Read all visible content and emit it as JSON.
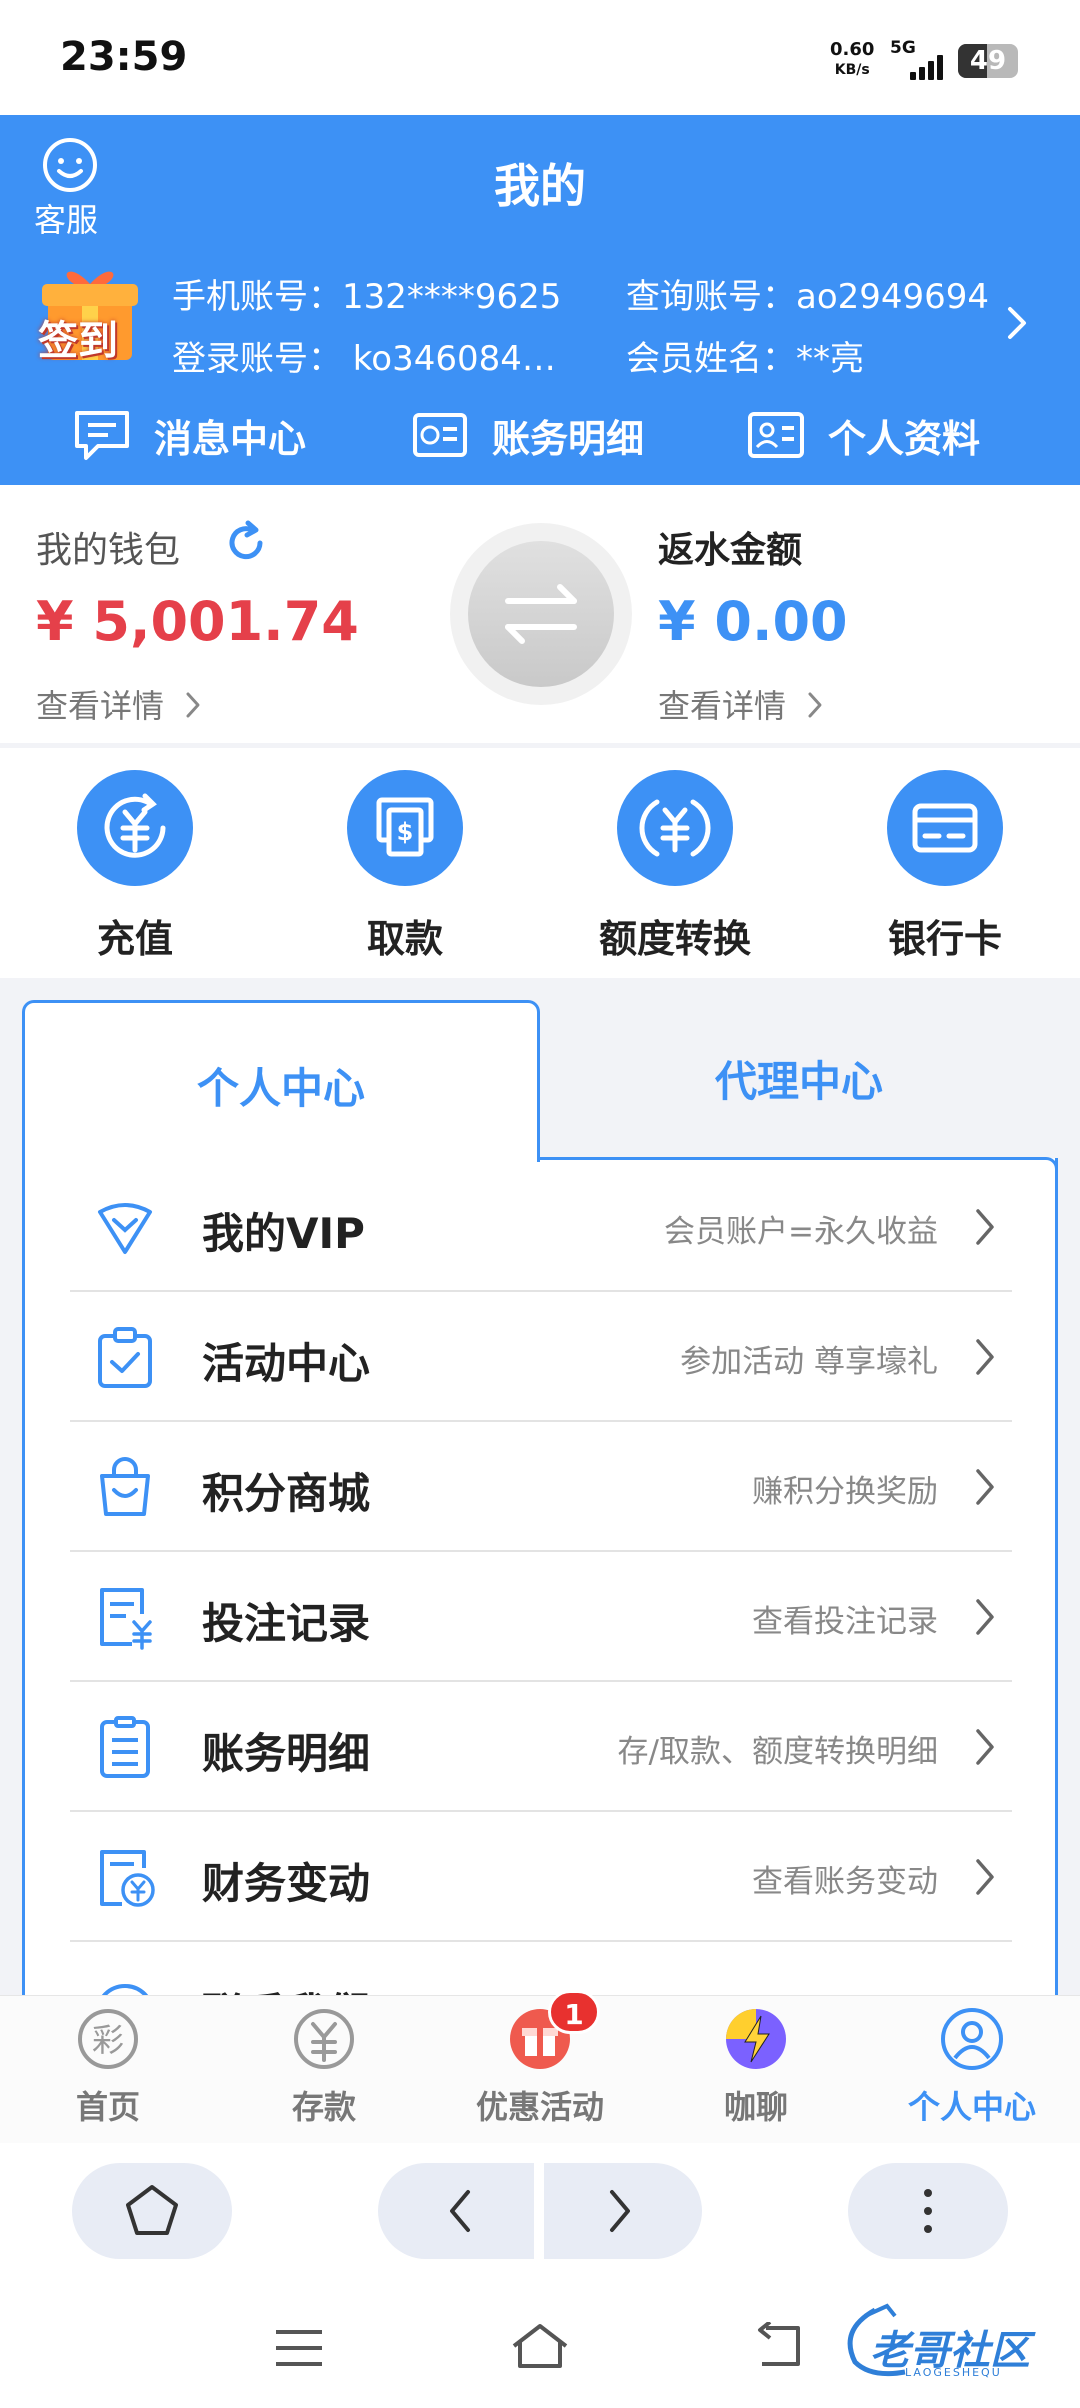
{
  "status_bar": {
    "time": "23:59",
    "net_speed": "0.60",
    "net_unit": "KB/s",
    "network": "5G",
    "battery": "49",
    "battery_level": 0.49
  },
  "header": {
    "customer_service_label": "客服",
    "title": "我的",
    "signin_label": "签到",
    "phone_account": "手机账号：132****9625",
    "query_account": "查询账号：ao2949694",
    "login_account": "登录账号：  ko346084…",
    "member_name": "会员姓名：**亮",
    "quick_links": [
      {
        "label": "消息中心",
        "icon": "message-icon"
      },
      {
        "label": "账务明细",
        "icon": "bill-icon"
      },
      {
        "label": "个人资料",
        "icon": "profile-card-icon"
      }
    ]
  },
  "wallet": {
    "label": "我的钱包",
    "amount": "¥ 5,001.74",
    "detail_label": "查看详情",
    "rebate_label": "返水金额",
    "rebate_amount": "¥ 0.00",
    "rebate_detail_label": "查看详情",
    "accent_red": "#e5404a",
    "accent_blue": "#3d91f5"
  },
  "actions": [
    {
      "label": "充值",
      "icon": "deposit-icon"
    },
    {
      "label": "取款",
      "icon": "withdraw-icon"
    },
    {
      "label": "额度转换",
      "icon": "transfer-icon"
    },
    {
      "label": "银行卡",
      "icon": "bank-card-icon"
    }
  ],
  "tabs": {
    "personal": "个人中心",
    "agent": "代理中心"
  },
  "menu": [
    {
      "title": "我的VIP",
      "sub": "会员账户=永久收益",
      "icon": "vip-diamond-icon"
    },
    {
      "title": "活动中心",
      "sub": "参加活动 尊享壕礼",
      "icon": "clipboard-check-icon"
    },
    {
      "title": "积分商城",
      "sub": "赚积分换奖励",
      "icon": "shopping-bag-icon"
    },
    {
      "title": "投注记录",
      "sub": "查看投注记录",
      "icon": "bet-record-icon"
    },
    {
      "title": "账务明细",
      "sub": "存/取款、额度转换明细",
      "icon": "ledger-icon"
    },
    {
      "title": "财务变动",
      "sub": "查看账务变动",
      "icon": "finance-change-icon"
    },
    {
      "title": "联系我们",
      "sub": "",
      "icon": "contact-icon"
    }
  ],
  "bottom_nav": [
    {
      "label": "首页",
      "icon": "lottery-icon"
    },
    {
      "label": "存款",
      "icon": "yuan-icon"
    },
    {
      "label": "优惠活动",
      "icon": "gift-icon",
      "badge": "1"
    },
    {
      "label": "咖聊",
      "icon": "chat-bolt-icon"
    },
    {
      "label": "个人中心",
      "icon": "user-icon",
      "active": true
    }
  ],
  "watermark": {
    "text": "老哥社区",
    "sub": "LAOGESHEQU"
  }
}
